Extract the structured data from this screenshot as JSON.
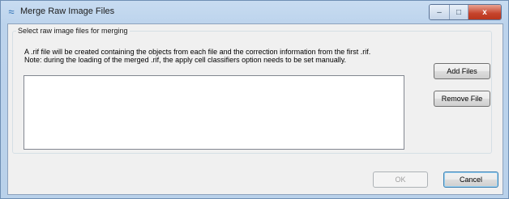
{
  "window": {
    "title": "Merge Raw Image Files",
    "icon": "tilde-wave-icon",
    "controls": {
      "minimize": "–",
      "maximize": "□",
      "close": "x"
    }
  },
  "group": {
    "legend": "Select raw image files for merging",
    "info_line_1": "A .rif file will be created containing the objects from each file and the correction information from the first .rif.",
    "info_line_2": "Note: during the loading of the merged .rif, the apply cell classifiers option needs to be set manually."
  },
  "file_list": {
    "items": []
  },
  "buttons": {
    "add_files": "Add Files",
    "remove_file": "Remove File",
    "ok": "OK",
    "cancel": "Cancel"
  },
  "colors": {
    "title_bar": "#bcd3ec",
    "client_bg": "#f0f0f0",
    "close_button": "#c5432b",
    "default_button_border": "#3c7fb1"
  }
}
